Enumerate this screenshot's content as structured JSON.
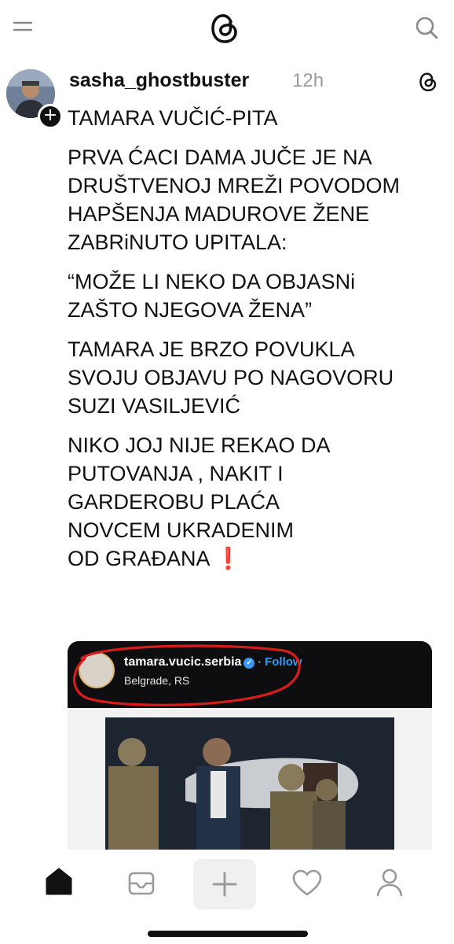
{
  "post": {
    "username": "sasha_ghostbuster",
    "timestamp": "12h",
    "paragraphs": [
      "TAMARA VUČIĆ-PITA",
      "PRVA ĆACI DAMA JUČE JE NA\nDRUŠTVENOJ MREŽI POVODOM\nHAPŠENJA MADUROVE ŽENE\nZABRiNUTO UPITALA:",
      "“MOŽE LI NEKO DA OBJASNi\nZAŠTO NJEGOVA ŽENA”",
      "TAMARA JE BRZO POVUKLA\nSVOJU OBJAVU PO NAGOVORU\nSUZI VASILJEVIĆ",
      "NIKO JOJ NIJE REKAO DA\nPUTOVANJA , NAKIT I\nGARDEROBU PLAĆA\nNOVCEM UKRADENIM\nOD GRAĐANA"
    ],
    "exclamation": "❗"
  },
  "embed": {
    "username": "tamara.vucic.serbia",
    "verified_mark": "✓",
    "separator": "·",
    "follow_label": "Follow",
    "location": "Belgrade, RS",
    "follow_color": "#3897f0",
    "annotation_color": "#d81c1c"
  },
  "icons": {
    "top": [
      "menu-icon",
      "threads-logo-icon",
      "search-icon"
    ],
    "tabbar": [
      "home-icon",
      "inbox-icon",
      "compose-icon",
      "heart-icon",
      "profile-icon"
    ]
  }
}
